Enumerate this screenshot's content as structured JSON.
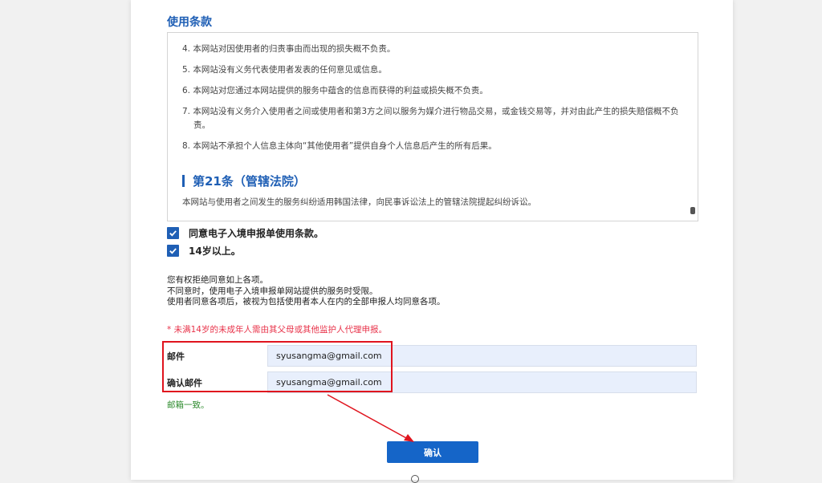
{
  "terms": {
    "title": "使用条款",
    "items": [
      "4. 本网站对因使用者的归责事由而出现的损失概不负责。",
      "5. 本网站没有义务代表使用者发表的任何意见或信息。",
      "6. 本网站对您通过本网站提供的服务中蕴含的信息而获得的利益或损失概不负责。",
      "7. 本网站没有义务介入使用者之间或使用者和第3方之间以服务为媒介进行物品交易，或金钱交易等，并对由此产生的损失赔偿概不负责。",
      "8. 本网站不承担个人信息主体向“其他使用者”提供自身个人信息后产生的所有后果。"
    ],
    "article_title": "第21条（管辖法院）",
    "article_body": "本网站与使用者之间发生的服务纠纷适用韩国法律，向民事诉讼法上的管辖法院提起纠纷诉讼。"
  },
  "agreements": {
    "agree_terms": "同意电子入境申报单使用条款。",
    "age_14": "14岁以上。"
  },
  "notice": {
    "line1": "您有权拒绝同意如上各项。",
    "line2": "不同意时，使用电子入境申报单网站提供的服务时受限。",
    "line3": "使用者同意各项后，被视为包括使用者本人在内的全部申报人均同意各项。"
  },
  "warning": "* 未满14岁的未成年人需由其父母或其他监护人代理申报。",
  "form": {
    "email_label": "邮件",
    "email_value": "syusangma@gmail.com",
    "confirm_email_label": "确认邮件",
    "confirm_email_value": "syusangma@gmail.com",
    "match_message": "邮箱一致。"
  },
  "confirm_button": "确认",
  "colors": {
    "accent": "#1f5fb5",
    "button": "#1565c8",
    "warning": "#e8334a",
    "success": "#2e8b2e",
    "annotation": "#e0141e"
  }
}
